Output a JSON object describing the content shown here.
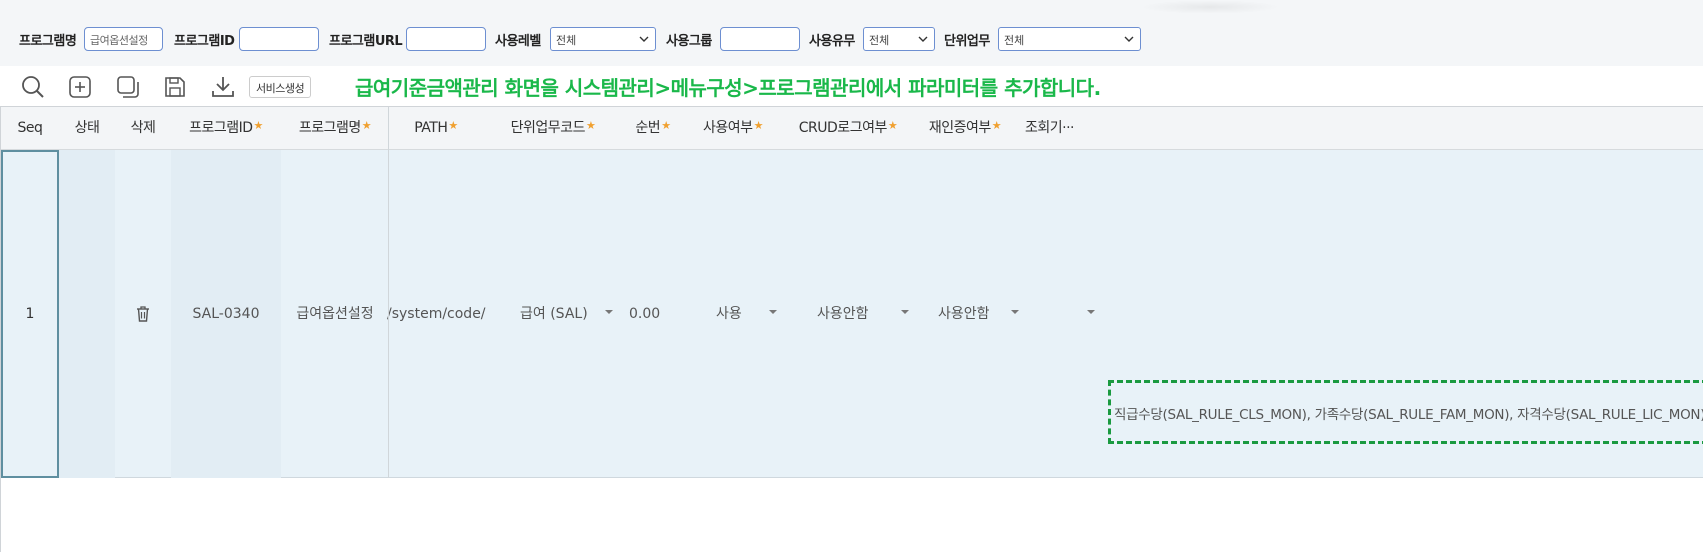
{
  "filters": {
    "program_name": {
      "label": "프로그램명",
      "value": "급여옵션설정"
    },
    "program_id": {
      "label": "프로그램ID",
      "value": ""
    },
    "program_url": {
      "label": "프로그램URL",
      "value": ""
    },
    "use_level": {
      "label": "사용레벨",
      "selected": "전체"
    },
    "use_group": {
      "label": "사용그룹",
      "value": ""
    },
    "use_yn": {
      "label": "사용유무",
      "selected": "전체"
    },
    "unit_task": {
      "label": "단위업무",
      "selected": "전체"
    }
  },
  "toolbar": {
    "icons": [
      "search-icon",
      "add-icon",
      "copy-icon",
      "save-icon",
      "download-icon"
    ],
    "service_create_label": "서비스생성",
    "notice": "급여기준금액관리 화면을 시스템관리>메뉴구성>프로그램관리에서 파라미터를 추가합니다."
  },
  "grid": {
    "columns": [
      {
        "label": "Seq",
        "required": false
      },
      {
        "label": "상태",
        "required": false
      },
      {
        "label": "삭제",
        "required": false
      },
      {
        "label": "프로그램ID",
        "required": true
      },
      {
        "label": "프로그램명",
        "required": true
      },
      {
        "label": "PATH",
        "required": true
      },
      {
        "label": "단위업무코드",
        "required": true
      },
      {
        "label": "순번",
        "required": true
      },
      {
        "label": "사용여부",
        "required": true
      },
      {
        "label": "CRUD로그여부",
        "required": true
      },
      {
        "label": "재인증여부",
        "required": true
      },
      {
        "label": "조회기···",
        "required": false
      }
    ],
    "required_mark": "★",
    "rows": [
      {
        "seq": "1",
        "status": "",
        "program_id": "SAL-0340",
        "program_name": "급여옵션설정",
        "path": "/system/code/",
        "unit_task_code": "급여 (SAL)",
        "order": "0.00",
        "use_yn": "사용",
        "crud_log": "사용안함",
        "reauth": "사용안함",
        "query_period": "",
        "parameters": "직급수당(SAL_RULE_CLS_MON), 가족수당(SAL_RULE_FAM_MON), 자격수당(SAL_RULE_LIC_MON)"
      }
    ]
  },
  "colors": {
    "notice_green": "#1ab84a",
    "highlight_dash": "#1a9a40",
    "row_selected_bg": "#e8f2f8",
    "required_star": "#f0a030",
    "input_border": "#6d8fd1"
  }
}
